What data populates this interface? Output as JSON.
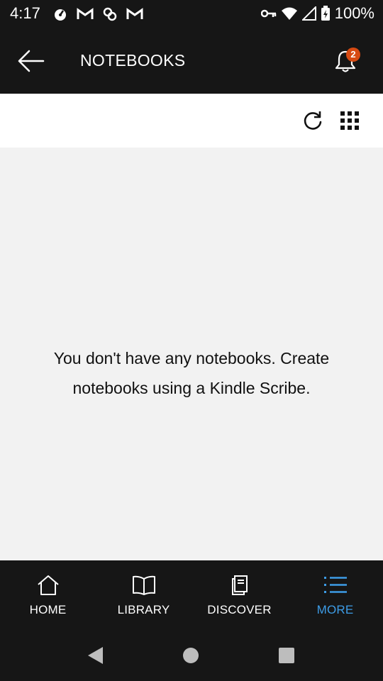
{
  "status_bar": {
    "time": "4:17",
    "battery_percent": "100%"
  },
  "app_bar": {
    "title": "NOTEBOOKS",
    "notification_count": "2",
    "badge_color": "#d74a12"
  },
  "toolbar": {
    "icons": [
      "refresh-icon",
      "grid-view-icon"
    ]
  },
  "content": {
    "empty_message": "You don't have any notebooks. Create notebooks using a Kindle Scribe."
  },
  "bottom_nav": {
    "active_color": "#3d9ce6",
    "items": [
      {
        "label": "HOME",
        "icon": "home-icon"
      },
      {
        "label": "LIBRARY",
        "icon": "book-icon"
      },
      {
        "label": "DISCOVER",
        "icon": "discover-icon"
      },
      {
        "label": "MORE",
        "icon": "menu-list-icon",
        "active": true
      }
    ]
  },
  "system_nav": {
    "buttons": [
      "back",
      "home",
      "recents"
    ]
  }
}
